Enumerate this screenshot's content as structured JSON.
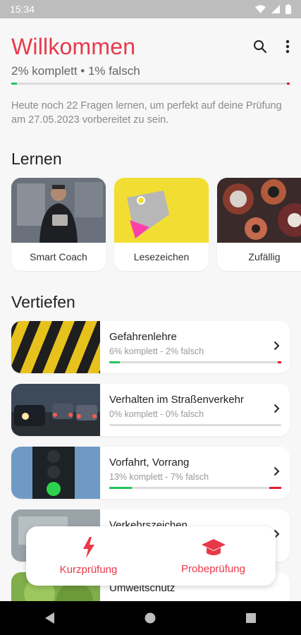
{
  "status": {
    "time": "15:34"
  },
  "header": {
    "title": "Willkommen",
    "subtitle": "2% komplett • 1% falsch",
    "progress": {
      "complete": 0.02,
      "wrong": 0.01
    },
    "info": "Heute noch 22 Fragen lernen, um perfekt auf deine Prüfung am 27.05.2023 vorbereitet zu sein."
  },
  "sections": {
    "learn": "Lernen",
    "deepen": "Vertiefen"
  },
  "learn_cards": [
    {
      "label": "Smart Coach"
    },
    {
      "label": "Lesezeichen"
    },
    {
      "label": "Zufällig"
    }
  ],
  "topics": [
    {
      "name": "Gefahrenlehre",
      "meta": "6% komplett - 2% falsch",
      "complete": 0.06,
      "wrong": 0.02
    },
    {
      "name": "Verhalten im Straßenverkehr",
      "meta": "0% komplett - 0% falsch",
      "complete": 0.0,
      "wrong": 0.0
    },
    {
      "name": "Vorfahrt, Vorrang",
      "meta": "13% komplett - 7% falsch",
      "complete": 0.13,
      "wrong": 0.07
    },
    {
      "name": "Verkehrszeichen",
      "meta": "",
      "complete": 0.0,
      "wrong": 0.0
    },
    {
      "name": "Umweltschutz",
      "meta": "",
      "complete": 0.0,
      "wrong": 0.0
    }
  ],
  "bottom_actions": {
    "quick": "Kurzprüfung",
    "exam": "Probeprüfung"
  },
  "colors": {
    "accent": "#e8394a",
    "ok": "#22c55e",
    "wrong": "#e11d2e"
  }
}
